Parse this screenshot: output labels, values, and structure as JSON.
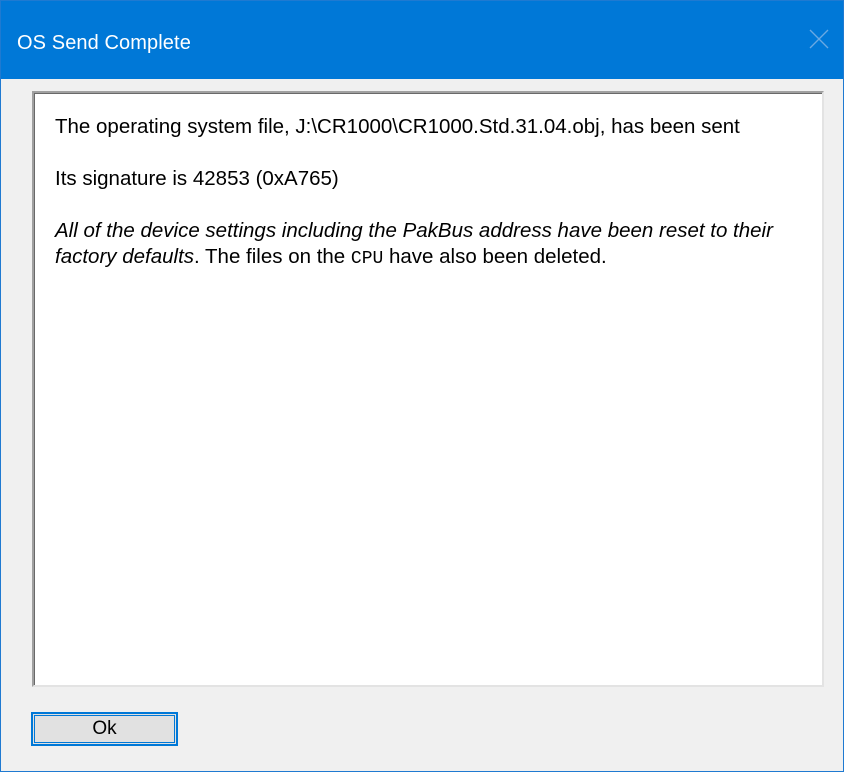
{
  "window": {
    "title": "OS Send Complete"
  },
  "message": {
    "line1": "The operating system file, J:\\CR1000\\CR1000.Std.31.04.obj, has been sent",
    "signature": "Its signature is 42853 (0xA765)",
    "reset_italic": "All of the device settings including the PakBus address have been reset to their factory defaults",
    "reset_after": ". The files on the ",
    "cpu_label": "CPU",
    "reset_end": " have also been deleted."
  },
  "buttons": {
    "ok_label": "Ok"
  },
  "colors": {
    "titlebar": "#0078d7",
    "dialog_bg": "#f0f0f0",
    "panel_bg": "#ffffff",
    "button_border": "#0078d7"
  }
}
